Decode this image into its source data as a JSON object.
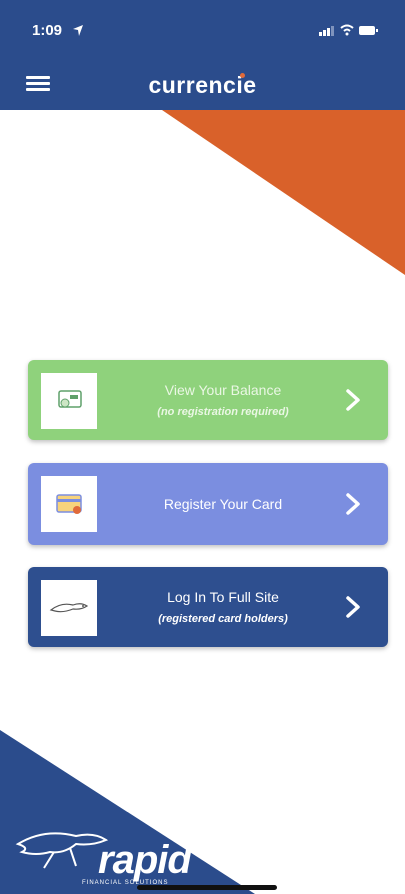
{
  "status": {
    "time": "1:09",
    "icons": "signal wifi battery"
  },
  "header": {
    "logo": "currencie",
    "menu_icon": "hamburger-icon"
  },
  "colors": {
    "primary_blue": "#2b4c8c",
    "orange": "#d9612a",
    "balance_green": "#8fd27c",
    "register_purple": "#7b8ee0",
    "login_navy": "#2e4f8f"
  },
  "cards": [
    {
      "title": "View Your Balance",
      "subtitle": "(no registration required)",
      "icon": "balance-icon"
    },
    {
      "title": "Register Your Card",
      "subtitle": "",
      "icon": "card-register-icon"
    },
    {
      "title": "Log In To Full Site",
      "subtitle": "(registered card holders)",
      "icon": "cheetah-icon"
    }
  ],
  "footer": {
    "brand": "rapid",
    "brand_sub": "FINANCIAL SOLUTIONS"
  }
}
